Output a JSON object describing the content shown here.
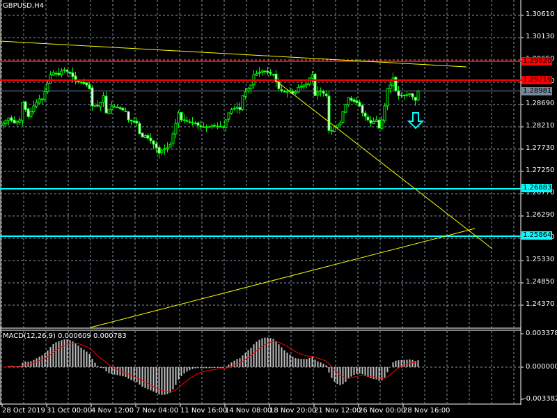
{
  "window": {
    "title": "GBPUSD,H4"
  },
  "colors": {
    "bull": "#00ff00",
    "bear_body": "#ffffff",
    "grid": "#8899aa",
    "trend": "#ffff00",
    "resistance": "#ff0000",
    "support": "#00ffff",
    "bid": "#778899",
    "signal": "#ff0000",
    "hist": "#c0c0c0"
  },
  "price_axis": {
    "ticks": [
      "1.30610",
      "1.30130",
      "1.29650",
      "1.29170",
      "1.28690",
      "1.28210",
      "1.27730",
      "1.27250",
      "1.26770",
      "1.26290",
      "1.25810",
      "1.25330",
      "1.24850",
      "1.24370"
    ]
  },
  "price_tags": [
    {
      "value": "1.29620",
      "kind": "resistance"
    },
    {
      "value": "1.29219",
      "kind": "resistance"
    },
    {
      "value": "1.28981",
      "kind": "bid"
    },
    {
      "value": "1.26883",
      "kind": "support"
    },
    {
      "value": "1.25864",
      "kind": "support"
    }
  ],
  "time_axis": [
    "28 Oct 2019",
    "31 Oct 00:00",
    "4 Nov 12:00",
    "7 Nov 04:00",
    "11 Nov 16:00",
    "14 Nov 08:00",
    "18 Nov 20:00",
    "21 Nov 12:00",
    "26 Nov 00:00",
    "28 Nov 16:00"
  ],
  "macd": {
    "label": "MACD(12,26,9) 0.000609 0.000783",
    "axis": [
      "0.003378",
      "0.000000",
      "-0.003382"
    ]
  },
  "chart_data": {
    "type": "candlestick",
    "symbol": "GBPUSD",
    "timeframe": "H4",
    "close_path": [
      [
        0,
        1.2829
      ],
      [
        2,
        1.284
      ],
      [
        4,
        1.2829
      ],
      [
        6,
        1.2836
      ],
      [
        7,
        1.2873
      ],
      [
        9,
        1.2843
      ],
      [
        11,
        1.2866
      ],
      [
        13,
        1.2881
      ],
      [
        14,
        1.2881
      ],
      [
        16,
        1.2914
      ],
      [
        17,
        1.2933
      ],
      [
        18,
        1.2938
      ],
      [
        20,
        1.2933
      ],
      [
        21,
        1.2941
      ],
      [
        22,
        1.2944
      ],
      [
        24,
        1.2936
      ],
      [
        25,
        1.2929
      ],
      [
        26,
        1.292
      ],
      [
        29,
        1.2914
      ],
      [
        30,
        1.2911
      ],
      [
        31,
        1.2903
      ],
      [
        32,
        1.2866
      ],
      [
        34,
        1.2866
      ],
      [
        35,
        1.2873
      ],
      [
        36,
        1.2888
      ],
      [
        37,
        1.2851
      ],
      [
        39,
        1.2866
      ],
      [
        41,
        1.2863
      ],
      [
        44,
        1.2854
      ],
      [
        45,
        1.2836
      ],
      [
        48,
        1.2829
      ],
      [
        49,
        1.2806
      ],
      [
        50,
        1.2799
      ],
      [
        51,
        1.2802
      ],
      [
        53,
        1.2791
      ],
      [
        55,
        1.2776
      ],
      [
        56,
        1.2764
      ],
      [
        57,
        1.2771
      ],
      [
        59,
        1.2776
      ],
      [
        60,
        1.2783
      ],
      [
        61,
        1.2806
      ],
      [
        63,
        1.2851
      ],
      [
        64,
        1.2836
      ],
      [
        65,
        1.2836
      ],
      [
        66,
        1.2833
      ],
      [
        69,
        1.2829
      ],
      [
        70,
        1.2824
      ],
      [
        71,
        1.2821
      ],
      [
        74,
        1.2821
      ],
      [
        75,
        1.2824
      ],
      [
        78,
        1.2821
      ],
      [
        79,
        1.2821
      ],
      [
        81,
        1.2851
      ],
      [
        82,
        1.2858
      ],
      [
        84,
        1.2863
      ],
      [
        85,
        1.2858
      ],
      [
        86,
        1.2888
      ],
      [
        87,
        1.2896
      ],
      [
        89,
        1.2911
      ],
      [
        90,
        1.2933
      ],
      [
        92,
        1.2938
      ],
      [
        93,
        1.2941
      ],
      [
        95,
        1.2938
      ],
      [
        97,
        1.2933
      ],
      [
        99,
        1.2903
      ],
      [
        100,
        1.2899
      ],
      [
        101,
        1.2896
      ],
      [
        103,
        1.2899
      ],
      [
        104,
        1.2893
      ],
      [
        105,
        1.2896
      ],
      [
        106,
        1.2906
      ],
      [
        109,
        1.2914
      ],
      [
        110,
        1.2926
      ],
      [
        111,
        1.2933
      ],
      [
        112,
        1.2888
      ],
      [
        113,
        1.2896
      ],
      [
        114,
        1.2899
      ],
      [
        116,
        1.2888
      ],
      [
        117,
        1.2813
      ],
      [
        118,
        1.2813
      ],
      [
        119,
        1.2821
      ],
      [
        121,
        1.2829
      ],
      [
        122,
        1.2854
      ],
      [
        124,
        1.2884
      ],
      [
        125,
        1.2878
      ],
      [
        127,
        1.2873
      ],
      [
        128,
        1.2866
      ],
      [
        129,
        1.2851
      ],
      [
        131,
        1.2836
      ],
      [
        132,
        1.2829
      ],
      [
        134,
        1.2836
      ],
      [
        135,
        1.2818
      ],
      [
        136,
        1.2836
      ],
      [
        137,
        1.2866
      ],
      [
        138,
        1.2903
      ],
      [
        139,
        1.2911
      ],
      [
        140,
        1.2926
      ],
      [
        141,
        1.2899
      ],
      [
        142,
        1.2888
      ],
      [
        144,
        1.2888
      ],
      [
        145,
        1.289
      ],
      [
        146,
        1.2893
      ],
      [
        148,
        1.2878
      ],
      [
        149,
        1.2898
      ]
    ]
  }
}
